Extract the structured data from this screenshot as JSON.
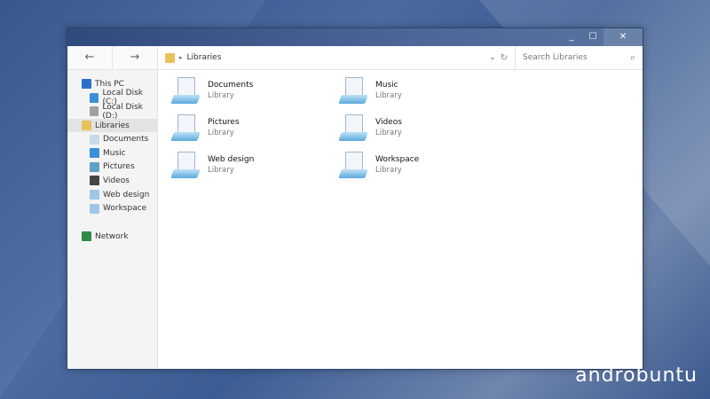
{
  "window": {
    "minimize": "_",
    "maximize": "☐",
    "close": "✕"
  },
  "toolbar": {
    "back": "←",
    "forward": "→",
    "breadcrumb": "Libraries",
    "separator": "▸",
    "dropdown": "⌄",
    "refresh": "↻",
    "search_placeholder": "Search Libraries",
    "search_icon": "⌕"
  },
  "sidebar": [
    {
      "label": "This PC",
      "icon": "computer-icon",
      "color": "#2a6fc9",
      "sub": false
    },
    {
      "label": "Local Disk (C:)",
      "icon": "system-drive-icon",
      "color": "#3b8fd8",
      "sub": true
    },
    {
      "label": "Local Disk (D:)",
      "icon": "drive-icon",
      "color": "#a0a0a0",
      "sub": true
    },
    {
      "label": "Libraries",
      "icon": "libraries-icon",
      "color": "#e8c15a",
      "sub": false,
      "selected": true
    },
    {
      "label": "Documents",
      "icon": "documents-icon",
      "color": "#c9d8ea",
      "sub": true
    },
    {
      "label": "Music",
      "icon": "music-icon",
      "color": "#3a8fd8",
      "sub": true
    },
    {
      "label": "Pictures",
      "icon": "pictures-icon",
      "color": "#5fa0c8",
      "sub": true
    },
    {
      "label": "Videos",
      "icon": "videos-icon",
      "color": "#444444",
      "sub": true
    },
    {
      "label": "Web design",
      "icon": "library-icon",
      "color": "#9fc6e8",
      "sub": true
    },
    {
      "label": "Workspace",
      "icon": "library-icon",
      "color": "#9fc6e8",
      "sub": true
    },
    {
      "label": "Network",
      "icon": "network-icon",
      "color": "#2f8a4a",
      "sub": false
    }
  ],
  "libraries": [
    {
      "name": "Documents",
      "type": "Library"
    },
    {
      "name": "Music",
      "type": "Library"
    },
    {
      "name": "Pictures",
      "type": "Library"
    },
    {
      "name": "Videos",
      "type": "Library"
    },
    {
      "name": "Web design",
      "type": "Library"
    },
    {
      "name": "Workspace",
      "type": "Library"
    }
  ],
  "watermark": "androbuntu"
}
